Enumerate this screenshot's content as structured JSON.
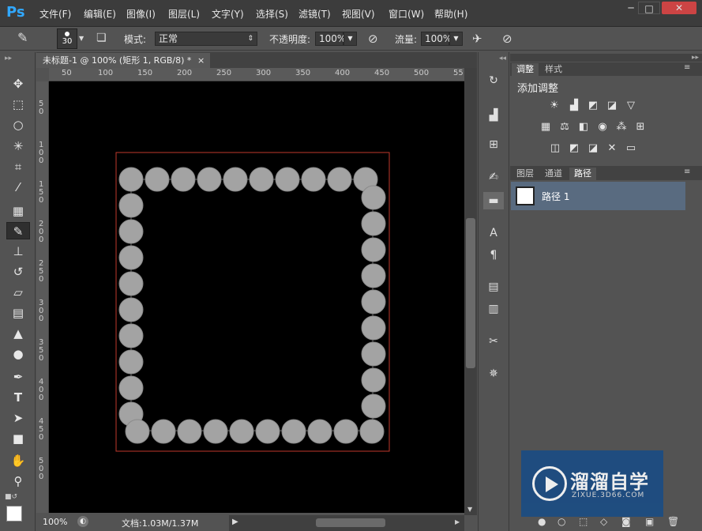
{
  "app": {
    "logo": "Ps"
  },
  "menu": [
    "文件(F)",
    "编辑(E)",
    "图像(I)",
    "图层(L)",
    "文字(Y)",
    "选择(S)",
    "滤镜(T)",
    "视图(V)",
    "窗口(W)",
    "帮助(H)"
  ],
  "window_controls": [
    "─",
    "□",
    "✕"
  ],
  "options": {
    "brush_size": "30",
    "mode_label": "模式:",
    "mode_value": "正常",
    "opacity_label": "不透明度:",
    "opacity_value": "100%",
    "flow_label": "流量:",
    "flow_value": "100%"
  },
  "document": {
    "tab_title": "未标题-1 @ 100% (矩形 1, RGB/8) *",
    "close": "×",
    "ruler_h": [
      "50",
      "100",
      "150",
      "200",
      "250",
      "300",
      "350",
      "400",
      "450",
      "500",
      "55"
    ],
    "ruler_v": [
      "5 0",
      "1 0 0",
      "1 5 0",
      "2 0 0",
      "2 5 0",
      "3 0 0",
      "3 5 0",
      "4 0 0",
      "4 5 0",
      "5 0 0"
    ]
  },
  "status": {
    "zoom": "100%",
    "doc_info": "文档:1.03M/1.37M"
  },
  "panels": {
    "adjust_tab": "调整",
    "styles_tab": "样式",
    "add_adjustment": "添加调整",
    "layers_tab": "图层",
    "channels_tab": "通道",
    "paths_tab": "路径",
    "path_item": "路径 1"
  },
  "watermark": {
    "title": "溜溜自学",
    "url": "ZIXUE.3D66.COM"
  },
  "colors": {
    "canvas_bg": "#000000",
    "circle": "#a3a3a3",
    "path_box": "#c0392b",
    "selection_row": "#596b80"
  },
  "icons": {
    "tools": [
      "move-icon",
      "marquee-icon",
      "lasso-icon",
      "magic-wand-icon",
      "crop-icon",
      "eyedropper-icon",
      "healing-icon",
      "brush-icon",
      "stamp-icon",
      "history-brush-icon",
      "eraser-icon",
      "gradient-icon",
      "blur-icon",
      "dodge-icon",
      "pen-icon",
      "type-icon",
      "path-select-icon",
      "rectangle-icon",
      "hand-icon",
      "zoom-icon"
    ]
  }
}
